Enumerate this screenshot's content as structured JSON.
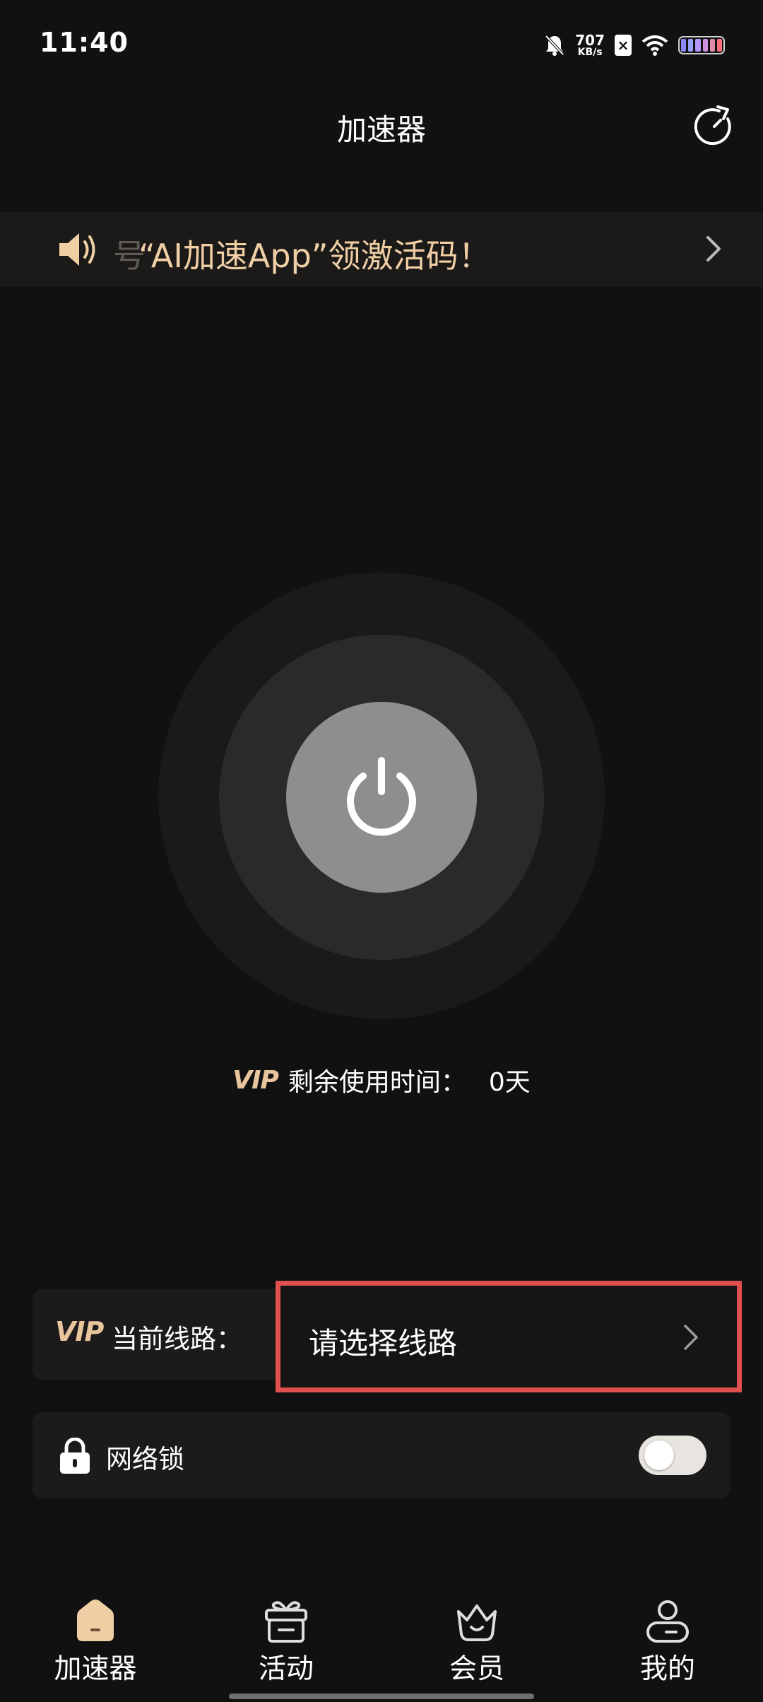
{
  "status_bar": {
    "time": "11:40",
    "net_speed_value": "707",
    "net_speed_unit": "KB/s",
    "sim_badge": "×",
    "battery_colors": [
      "#8d88ff",
      "#9aa3ff",
      "#b596ff",
      "#cf8fe0",
      "#e28aa8",
      "#ff6e7a"
    ]
  },
  "header": {
    "title": "加速器",
    "refresh_icon": "refresh-icon"
  },
  "notice": {
    "icon": "speaker-icon",
    "fade_char": "号",
    "text": "“AI加速App”领激活码！",
    "chevron": "chevron-right-icon"
  },
  "power": {
    "icon": "power-icon"
  },
  "vip_remaining": {
    "logo": "VIP",
    "label": "剩余使用时间：",
    "value": "0天"
  },
  "route": {
    "logo": "VIP",
    "label": "当前线路：",
    "placeholder": "请选择线路",
    "chevron": "chevron-right-icon"
  },
  "network_lock": {
    "icon": "lock-icon",
    "label": "网络锁",
    "enabled": false
  },
  "nav": {
    "items": [
      {
        "label": "加速器",
        "icon": "home-icon",
        "active": true
      },
      {
        "label": "活动",
        "icon": "gift-icon",
        "active": false
      },
      {
        "label": "会员",
        "icon": "crown-icon",
        "active": false
      },
      {
        "label": "我的",
        "icon": "profile-icon",
        "active": false
      }
    ]
  },
  "colors": {
    "background": "#111111",
    "accent_gold": "#e9c59d",
    "notice_text": "#f0cfa5",
    "highlight_border": "#e0504f"
  }
}
